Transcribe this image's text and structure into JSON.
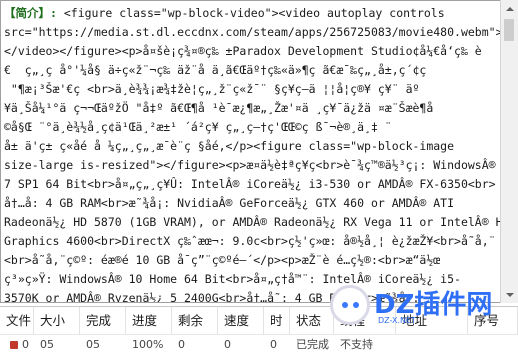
{
  "description": {
    "label": "【简介】:",
    "lines": [
      " <figure class=\"wp-block-video\"><video autoplay controls",
      "src=\"https://media.st.dl.eccdnx.com/steam/apps/256725083/movie480.webm\">",
      "</video></figure><p>å¤šè¡ç¾¤®­ç‰ ±Paradox Development Studio¢å¼€å‘ç‰ è",
      "€  ç„¸ç å°'¼å­§ ä÷ç«ž¨¬ç‰ ä­ž¨å ä¸­ã€Œäº†ç‰«ä»¶ç ã€æ¯‰ç„¸å±‚ç´¢ç",
      " \"¶æ¡³Šæ'€ç <br>ä¸è¾¾¡æ¾‡žè¦ç„¸ž¨ç«ž¯¨ §ç¥ç—ä ¦¦å¦ç®¥ ç¥¨ äº",
      "¥ä¸Šå¼¹°ä ­ç¬¬ŒäºžÖ \"å‡º ã€Œ¶å ¹è¯æ¿¶æ„¸Žæ'¤ä ¸ç¥¯ä¿žä ¤æ¨Šæè¶å ",
      "©å§Œ ¨°ä¸è¾½å­¸ç­¢ä¹Œä¸²æ±¹ ´á²ç¥ ç„¸ç—†ç'ŒŒ©ç ß¯¬è®¸ä¸‡ ¨",
      "å± ä'ç± ç«åé å ¼ç„¸ç„¸æ¯è¨ç §åé,</p><figure class=\"wp-block-image",
      "size-large is-resized\"></figure><p>æ¤ä½è‡ªç¥ç<br>è¯¾ç™®ä½³ç¡: WindowsÂ®",
      "7 SP1 64 Bit<br>å¤„ç„¸ç¥Û: IntelÂ® iCoreä½¿ i3-530 or AMDÂ® FX-6350<br>",
      "å†…å­: 4 GB RAM<br>æ˜¾å¡: NvidiaÂ® GeForceä½¿ GTX 460 or AMDÂ® ATI",
      "Radeonä½¿ HD 5870 (1GB VRAM), or AMDÂ® Radeonä½¿ RX Vega 11 or IntelÂ® HD",
      "Graphics 4600<br>DirectX ç‰ˆæœ¬: 9.0c<br>ç½'ç»œ: å®½å¸¦ è¿žæŽ¥<br>å­˜å‚¨",
      "<br>å­˜å‚¨ç©º: éæ®é 10 GB å¯ç”¨ç©ºé—´</p><p>æŽ¨è é…ç½®:<br>æ“ä½œ",
      "ç³»ç»Ÿ: WindowsÂ® 10 Home 64 Bit<br>å¤„ç†å™¨: IntelÂ® iCoreä½¿ i5-",
      "3570K or AMDÂ® Ryzenä½¿ 5 2400G<br>å†…å­˜: 4 GB RAM<br>æ˜¾å¡:"
    ]
  },
  "task_list": {
    "headers": [
      "文件",
      "大小",
      "完成",
      "进度",
      "剩余",
      "速度",
      "时",
      "状态",
      "线程",
      "地址",
      "序号"
    ],
    "row": [
      "0",
      "05",
      "05",
      "100%",
      "0",
      "0",
      "0",
      "已完成",
      "不支持",
      "",
      ""
    ]
  },
  "watermark": {
    "text": "DZ插件网",
    "sub": "DZ-X.NET"
  }
}
